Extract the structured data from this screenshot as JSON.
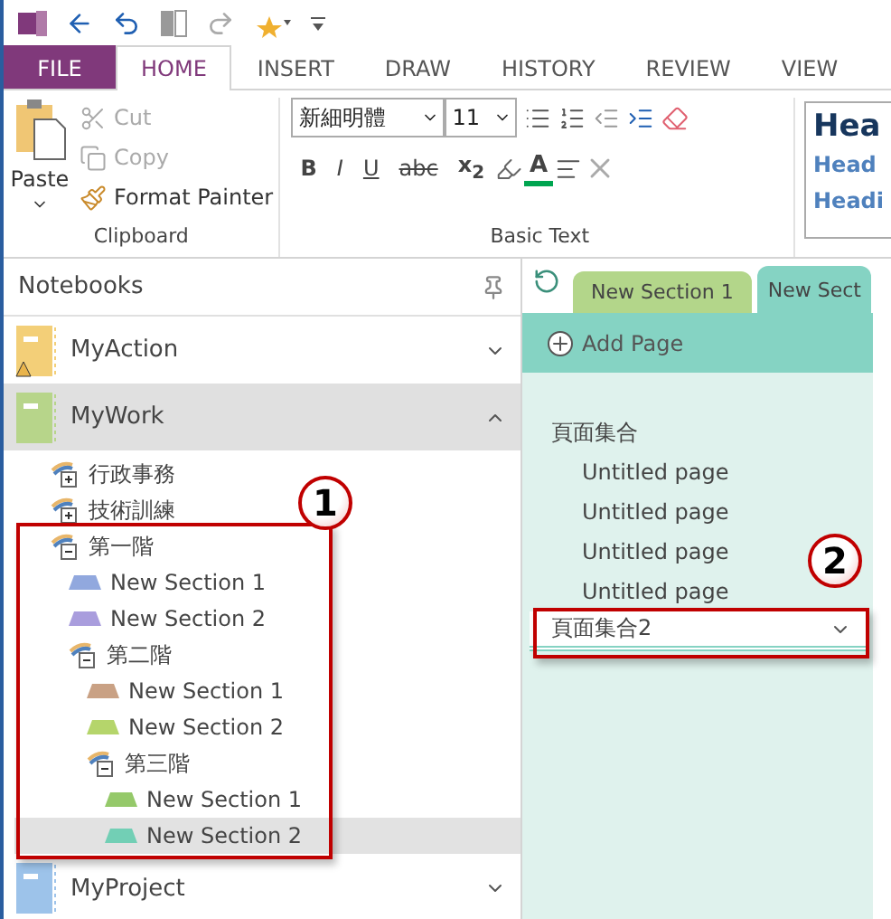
{
  "ribbon": {
    "tabs": [
      {
        "label": "FILE",
        "kind": "file",
        "selected": false
      },
      {
        "label": "HOME",
        "kind": "tab",
        "selected": true
      },
      {
        "label": "INSERT",
        "kind": "tab",
        "selected": false
      },
      {
        "label": "DRAW",
        "kind": "tab",
        "selected": false
      },
      {
        "label": "HISTORY",
        "kind": "tab",
        "selected": false
      },
      {
        "label": "REVIEW",
        "kind": "tab",
        "selected": false
      },
      {
        "label": "VIEW",
        "kind": "tab",
        "selected": false
      }
    ],
    "clipboard": {
      "paste": "Paste",
      "cut": {
        "label": "Cut",
        "disabled": true
      },
      "copy": {
        "label": "Copy",
        "disabled": true
      },
      "format_painter": {
        "label": "Format Painter",
        "disabled": false
      },
      "group_label": "Clipboard"
    },
    "basic_text": {
      "font": "新細明體",
      "size": "11",
      "bold": "B",
      "italic": "I",
      "underline": "U",
      "strikethrough": "abc",
      "subscript": "x$_{2}$",
      "font_color": "A",
      "group_label": "Basic Text"
    },
    "styles": [
      "Hea",
      "Head",
      "Headi"
    ]
  },
  "notebooks": {
    "title": "Notebooks",
    "items": [
      {
        "name": "MyAction",
        "color": "#f3cf78",
        "expanded": false,
        "selected": false,
        "warning": true
      },
      {
        "name": "MyWork",
        "color": "#b7d58a",
        "expanded": true,
        "selected": true,
        "warning": false,
        "children": [
          {
            "kind": "group",
            "label": "行政事務",
            "expanded": false,
            "selected": false
          },
          {
            "kind": "group",
            "label": "技術訓練",
            "expanded": false,
            "selected": false
          },
          {
            "kind": "group",
            "label": "第一階",
            "expanded": true,
            "selected": false,
            "children": [
              {
                "kind": "section",
                "label": "New Section 1",
                "color": "#91a8de",
                "selected": false
              },
              {
                "kind": "section",
                "label": "New Section 2",
                "color": "#a99ddd",
                "selected": false
              },
              {
                "kind": "group",
                "label": "第二階",
                "expanded": true,
                "selected": false,
                "children": [
                  {
                    "kind": "section",
                    "label": "New Section 1",
                    "color": "#c9a184",
                    "selected": false
                  },
                  {
                    "kind": "section",
                    "label": "New Section 2",
                    "color": "#b5d56b",
                    "selected": false
                  },
                  {
                    "kind": "group",
                    "label": "第三階",
                    "expanded": true,
                    "selected": false,
                    "children": [
                      {
                        "kind": "section",
                        "label": "New Section 1",
                        "color": "#95c96a",
                        "selected": false
                      },
                      {
                        "kind": "section",
                        "label": "New Section 2",
                        "color": "#72cfb5",
                        "selected": true
                      }
                    ]
                  }
                ]
              }
            ]
          }
        ]
      },
      {
        "name": "MyProject",
        "color": "#9dc3ea",
        "expanded": false,
        "selected": false,
        "warning": false
      }
    ]
  },
  "section_tabs": [
    {
      "label": "New Section 1",
      "color": "#b3d68a",
      "selected": false
    },
    {
      "label": "New Sect",
      "color": "#85d3c3",
      "selected": true
    }
  ],
  "pages": {
    "add_page": "Add Page",
    "items": [
      {
        "kind": "group",
        "label": "頁面集合",
        "selected": false
      },
      {
        "kind": "page",
        "label": "Untitled page",
        "selected": false
      },
      {
        "kind": "page",
        "label": "Untitled page",
        "selected": false
      },
      {
        "kind": "page",
        "label": "Untitled page",
        "selected": false
      },
      {
        "kind": "page",
        "label": "Untitled page",
        "selected": false
      },
      {
        "kind": "group",
        "label": "頁面集合2",
        "selected": true
      }
    ]
  },
  "callouts": [
    "1",
    "2"
  ]
}
